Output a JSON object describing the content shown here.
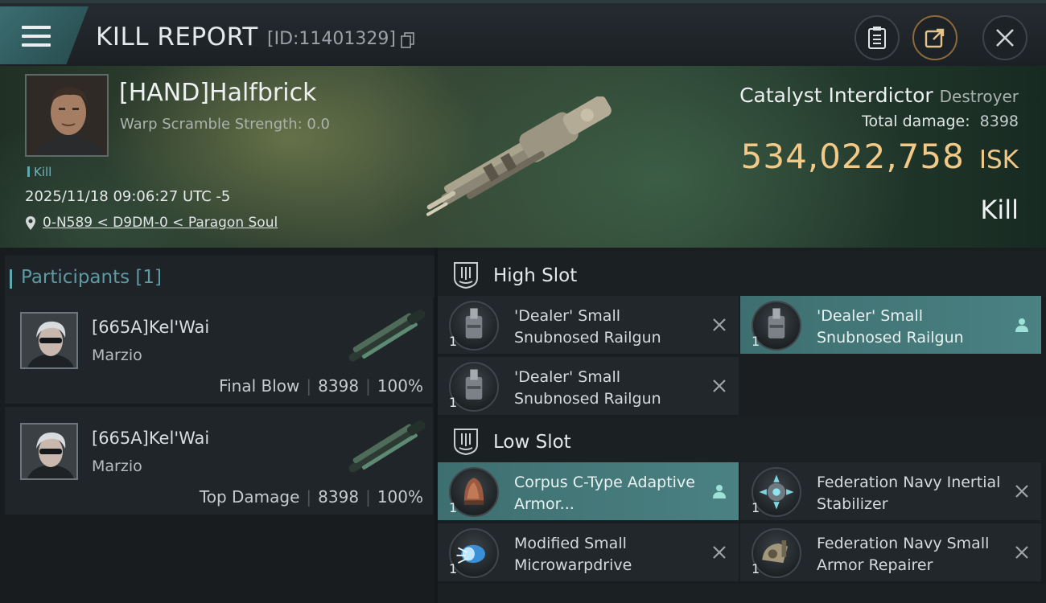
{
  "header": {
    "title": "KILL REPORT",
    "report_id": "[ID:11401329]"
  },
  "victim": {
    "name": "[HAND]Halfbrick",
    "warp_scramble": "Warp Scramble Strength: 0.0",
    "tag": "Kill",
    "timestamp": "2025/11/18 09:06:27 UTC -5",
    "location": "0-N589 < D9DM-0 < Paragon Soul",
    "ship_name": "Catalyst Interdictor",
    "ship_class": "Destroyer",
    "total_damage_label": "Total damage:",
    "total_damage": "8398",
    "isk_value": "534,022,758",
    "isk_unit": "ISK",
    "result": "Kill"
  },
  "participants": {
    "title": "Participants [1]",
    "list": [
      {
        "name": "[665A]Kel'Wai",
        "sub": "Marzio",
        "role": "Final Blow",
        "damage": "8398",
        "percent": "100%"
      },
      {
        "name": "[665A]Kel'Wai",
        "sub": "Marzio",
        "role": "Top Damage",
        "damage": "8398",
        "percent": "100%"
      }
    ]
  },
  "fitting": {
    "high_slot": {
      "title": "High Slot",
      "modules": [
        {
          "qty": "1",
          "name": "'Dealer' Small Snubnosed Railgun",
          "status": "destroyed"
        },
        {
          "qty": "1",
          "name": "'Dealer' Small Snubnosed Railgun",
          "status": "dropped"
        },
        {
          "qty": "1",
          "name": "'Dealer' Small Snubnosed Railgun",
          "status": "destroyed"
        }
      ]
    },
    "low_slot": {
      "title": "Low Slot",
      "modules": [
        {
          "qty": "1",
          "name": "Corpus C-Type Adaptive Armor...",
          "status": "dropped"
        },
        {
          "qty": "1",
          "name": "Federation Navy Inertial Stabilizer",
          "status": "destroyed"
        },
        {
          "qty": "1",
          "name": "Modified Small Microwarpdrive",
          "status": "destroyed"
        },
        {
          "qty": "1",
          "name": "Federation Navy Small Armor Repairer",
          "status": "destroyed"
        }
      ]
    }
  },
  "colors": {
    "accent_teal": "#4a8182",
    "isk_gold": "#f2c986",
    "panel_dark": "#1a1e21"
  }
}
